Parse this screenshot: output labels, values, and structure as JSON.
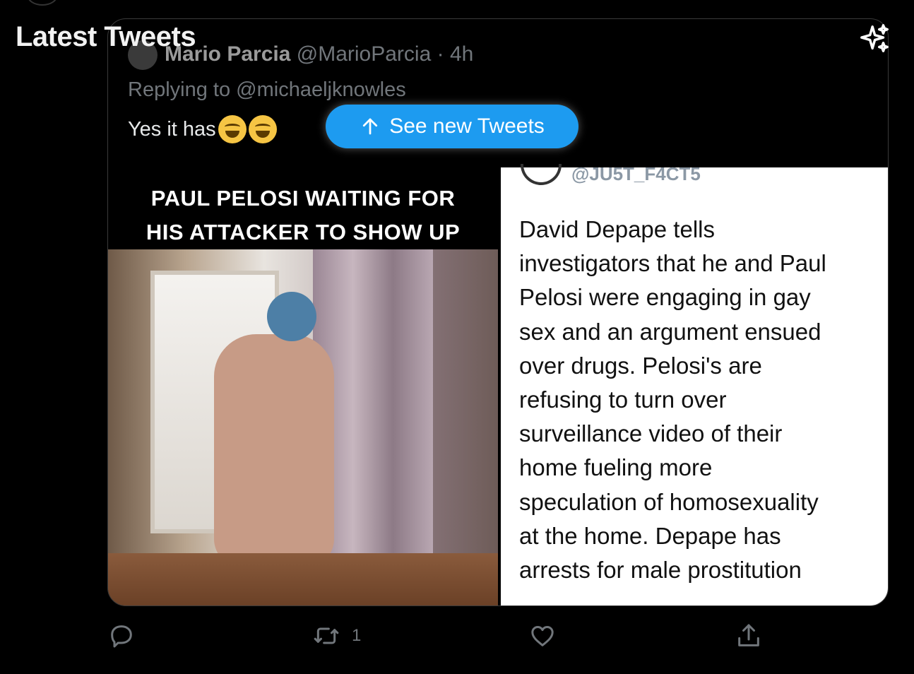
{
  "header": {
    "title": "Latest Tweets",
    "sparkle_icon": "sparkle-icon"
  },
  "quoted_tweet": {
    "name": "Mario Parcia",
    "handle": "@MarioParcia",
    "separator": "·",
    "time": "4h",
    "reply_prefix": "Replying to",
    "reply_to": "@michaeljknowles",
    "text": "Yes it has",
    "emoji_count": 2,
    "emoji_name": "face-with-tears-of-joy"
  },
  "new_tweets_button": {
    "label": "See new Tweets",
    "icon": "arrow-up-icon",
    "color": "#1d9bf0"
  },
  "media": {
    "meme_caption_line1": "PAUL PELOSI WAITING FOR",
    "meme_caption_line2": "HIS ATTACKER TO SHOW UP",
    "screenshot_handle": "@JU5T_F4CT5",
    "screenshot_text": "David Depape tells\ninvestigators that he and Paul\nPelosi were engaging in gay\nsex and an argument ensued\nover drugs. Pelosi's are\nrefusing to turn over\nsurveillance video of their\nhome fueling more\nspeculation of homosexuality\nat the home. Depape has\narrests for male prostitution"
  },
  "actions": {
    "reply_icon": "reply-icon",
    "retweet_icon": "retweet-icon",
    "retweet_count": "1",
    "like_icon": "heart-icon",
    "share_icon": "share-icon"
  },
  "colors": {
    "background": "#000000",
    "muted_text": "#71767b",
    "accent": "#1d9bf0"
  }
}
